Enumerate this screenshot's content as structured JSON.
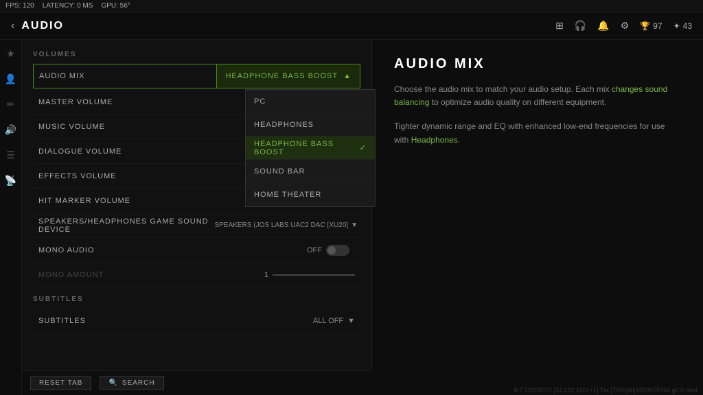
{
  "topbar": {
    "fps_label": "FPS:",
    "fps_value": "120",
    "latency_label": "LATENCY:",
    "latency_value": "0 MS",
    "gpu_label": "GPU:",
    "gpu_value": "56°"
  },
  "header": {
    "back_icon": "‹",
    "title": "AUDIO",
    "icons": [
      "⊞",
      "🎧",
      "🔔",
      "⚙",
      "🏆",
      "✦"
    ],
    "badge1_value": "97",
    "badge2_value": "43"
  },
  "sidebar": {
    "icons": [
      "★",
      "🎮",
      "✏",
      "🔊",
      "☰",
      "📡"
    ]
  },
  "volumes": {
    "section_title": "VOLUMES",
    "audio_mix_label": "AUDIO MIX",
    "audio_mix_value": "HEADPHONE BASS BOOST",
    "dropdown_open": true,
    "dropdown_items": [
      {
        "label": "PC",
        "selected": false
      },
      {
        "label": "HEADPHONES",
        "selected": false
      },
      {
        "label": "HEADPHONE BASS BOOST",
        "selected": true
      },
      {
        "label": "SOUND BAR",
        "selected": false
      },
      {
        "label": "HOME THEATER",
        "selected": false
      }
    ],
    "rows": [
      {
        "label": "MASTER VOLUME",
        "value": "",
        "has_star": true
      },
      {
        "label": "MUSIC VOLUME",
        "value": ""
      },
      {
        "label": "DIALOGUE VOLUME",
        "value": ""
      },
      {
        "label": "EFFECTS VOLUME",
        "value": ""
      },
      {
        "label": "HIT MARKER VOLUME",
        "value": ""
      }
    ],
    "speakers_label": "SPEAKERS/HEADPHONES GAME SOUND DEVICE",
    "speakers_value": "SPEAKERS (JOS LABS UAC2 DAC [XU20]",
    "mono_audio_label": "MONO AUDIO",
    "mono_audio_value": "OFF",
    "mono_amount_label": "MONO AMOUNT",
    "mono_amount_value": "1"
  },
  "subtitles": {
    "section_title": "SUBTITLES",
    "label": "SUBTITLES",
    "value": "ALL OFF"
  },
  "buttons": {
    "reset_label": "RESET TAB",
    "search_label": "SEARCH",
    "search_icon": "🔍"
  },
  "right_panel": {
    "title": "AUDIO MIX",
    "desc1_before": "Choose the audio mix to match your audio setup. Each mix ",
    "desc1_link": "changes sound balancing",
    "desc1_after": " to optimize audio quality on different equipment.",
    "desc2_before": "Tighter dynamic range and EQ with enhanced low-end frequencies for use with ",
    "desc2_link": "Headphones",
    "desc2_after": "."
  },
  "version": "8.7.13200072 [34:222:1561+1] Tm [7000[dll]1669655764 g0.0.bnet"
}
